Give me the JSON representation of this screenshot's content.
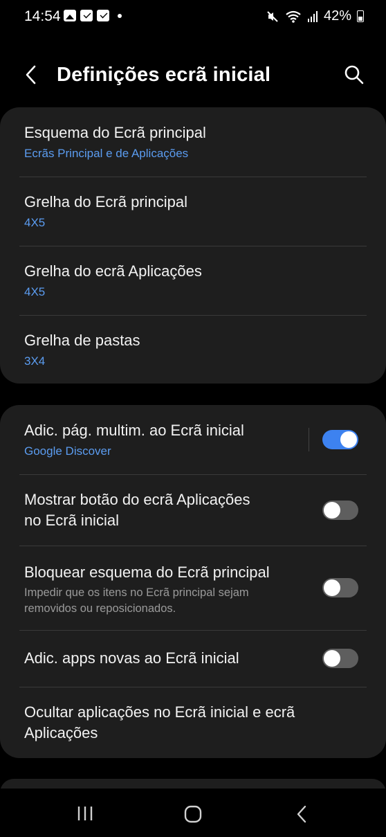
{
  "status_bar": {
    "time": "14:54",
    "battery": "42%",
    "icons": [
      "gallery-icon",
      "mail-icon",
      "mail-icon",
      "dot-icon",
      "mute-icon",
      "wifi-icon",
      "signal-icon",
      "battery-icon"
    ]
  },
  "header": {
    "title": "Definições ecrã inicial",
    "back_icon": "chevron-left-icon",
    "search_icon": "search-icon"
  },
  "group1": [
    {
      "title": "Esquema do Ecrã principal",
      "value": "Ecrãs Principal e de Aplicações"
    },
    {
      "title": "Grelha do Ecrã principal",
      "value": "4X5"
    },
    {
      "title": "Grelha do ecrã Aplicações",
      "value": "4X5"
    },
    {
      "title": "Grelha de pastas",
      "value": "3X4"
    }
  ],
  "group2": [
    {
      "title": "Adic. pág. multim. ao Ecrã inicial",
      "value": "Google Discover",
      "toggle": true
    },
    {
      "title_line1": "Mostrar botão do ecrã Aplicações",
      "title_line2": "no Ecrã inicial",
      "toggle": false
    },
    {
      "title": "Bloquear esquema do Ecrã principal",
      "desc_line1": "Impedir que os itens no Ecrã principal sejam",
      "desc_line2": "removidos ou reposicionados.",
      "toggle": false
    },
    {
      "title": "Adic. apps novas ao Ecrã inicial",
      "toggle": false
    },
    {
      "title_line1": "Ocultar aplicações no Ecrã inicial e ecrã",
      "title_line2": "Aplicações"
    }
  ],
  "nav_bar": {
    "icons": [
      "recents-icon",
      "home-icon",
      "back-icon"
    ]
  },
  "colors": {
    "background": "#000000",
    "card": "#1e1e1e",
    "accent": "#3d82f0",
    "subtitle": "#5b9cf0"
  }
}
